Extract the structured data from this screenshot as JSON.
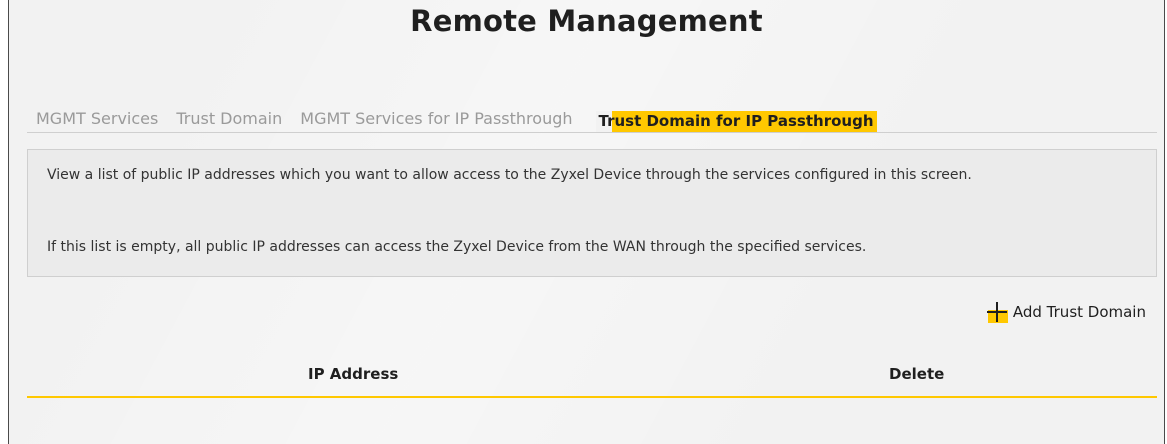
{
  "page": {
    "title": "Remote Management"
  },
  "tabs": [
    {
      "label": "MGMT Services",
      "active": false
    },
    {
      "label": "Trust Domain",
      "active": false
    },
    {
      "label": "MGMT Services for IP Passthrough",
      "active": false
    },
    {
      "label": "Trust Domain for IP Passthrough",
      "active": true
    }
  ],
  "info": {
    "line1": "View a list of public IP addresses which you want to allow access to the Zyxel Device through the services configured in this screen.",
    "line2": "If this list is empty, all public IP addresses can access the Zyxel Device from the WAN through the specified services."
  },
  "actions": {
    "add_icon": "plus-icon",
    "add_label": "Add Trust Domain"
  },
  "table": {
    "columns": [
      "IP Address",
      "Delete"
    ],
    "rows": []
  },
  "colors": {
    "accent": "#ffc800",
    "background": "#f2f2f2",
    "text": "#1f1f1f",
    "inactive_tab": "#9a9a9a"
  }
}
